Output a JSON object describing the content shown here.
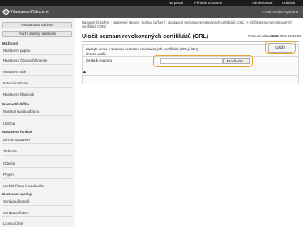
{
  "topbar": {
    "portal": "Na portál",
    "login_label": "Přihlásit uživatele : ",
    "user": "Administrator",
    "logout": "Odhlásit"
  },
  "header": {
    "app_title": "Nastavení/Uložení",
    "mail": "E-mail správci systému"
  },
  "sidebar": {
    "restore_button": "Restartovat zařízení",
    "apply_button": "Použít změny nastavení",
    "sections": {
      "preferences": "Možnosti",
      "function": "Nastavení funkce",
      "management": "Nastavení správy",
      "adjust": "Nastavit/Údržba"
    },
    "items": {
      "paper": "Nastavení papíru",
      "timer": "Nastavení Časovač/Energie",
      "network": "Nastavení sítě",
      "external": "Externí rozhraní",
      "accessibility": "Nastavení hlasitosti",
      "quality": "Nastavit kvalitu obrazu",
      "maintenance": "Údržba",
      "common": "Běžná nastavení",
      "printer": "Tiskárna",
      "send": "Odeslat",
      "receive": "Příjem",
      "store_access": "Uložit/Přístup k souborům",
      "user_mgmt": "Správa uživatelů",
      "device_mgmt": "Správa zařízení",
      "license": "Licence/Jiné"
    }
  },
  "main": {
    "breadcrumb": "Nastavení/Uložení : Nastavení správy : Správa zařízení : Nastavení seznamu revokovaných certifikátů (CRL) > Uložit seznam revokovaných certifikátů (CRL)",
    "page_title": "Uložit seznam revokovaných certifikátů (CRL)",
    "last_updated_label": "Poslední aktualizace :",
    "last_updated_value": "13/03 2021 18:46:55",
    "instruction": "Zadejte cestu k souboru seznamu revokovaných certifikátů (CRL), který chcete uložit.",
    "upload_button": "Uložit",
    "file_path_label": "Cesta k souboru",
    "file_path_value": "",
    "browse_button": "Procházet...",
    "back_to_top": "▲"
  },
  "colors": {
    "highlight": "#e8a52c",
    "header_bg": "#4d4d4d",
    "topbar_bg": "#1b1b1b"
  }
}
